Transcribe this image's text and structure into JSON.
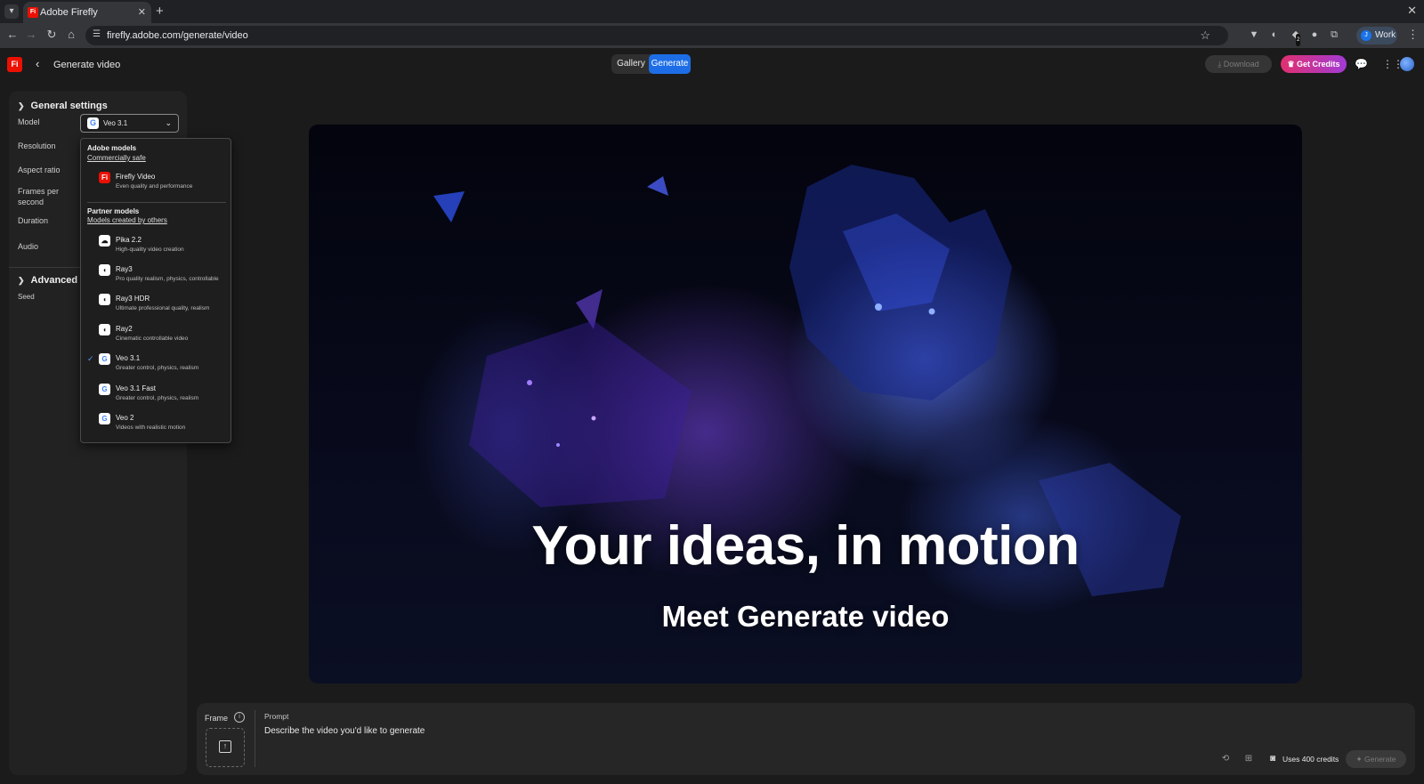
{
  "browser": {
    "tab_title": "Adobe Firefly",
    "tab_favicon": "Fi",
    "url": "firefly.adobe.com/generate/video",
    "extension_badge": "2",
    "profile_initial": "J",
    "profile_name": "Work"
  },
  "header": {
    "logo": "Fi",
    "page_title": "Generate video",
    "segments": [
      "Gallery",
      "Generate"
    ],
    "download_label": "Download",
    "credits_label": "Get Credits"
  },
  "settings": {
    "general_title": "General settings",
    "labels": {
      "model": "Model",
      "resolution": "Resolution",
      "aspect_ratio": "Aspect ratio",
      "fps": "Frames per second",
      "duration": "Duration",
      "audio": "Audio"
    },
    "advanced_title": "Advanced se",
    "seed_label": "Seed",
    "selected_model": "Veo 3.1"
  },
  "dropdown": {
    "adobe_group": {
      "title": "Adobe models",
      "subtitle": "Commercially safe"
    },
    "adobe_options": [
      {
        "name": "Firefly Video",
        "desc": "Even quality and performance",
        "icon": "firefly-icon"
      }
    ],
    "partner_group": {
      "title": "Partner models",
      "subtitle": "Models created by others"
    },
    "partner_options": [
      {
        "name": "Pika 2.2",
        "desc": "High-quality video creation",
        "icon": "pika-icon"
      },
      {
        "name": "Ray3",
        "desc": "Pro quality realism, physics, controllable",
        "icon": "luma-icon"
      },
      {
        "name": "Ray3 HDR",
        "desc": "Ultimate professional quality, realism",
        "icon": "luma-icon"
      },
      {
        "name": "Ray2",
        "desc": "Cinematic controllable video",
        "icon": "luma-icon"
      },
      {
        "name": "Veo 3.1",
        "desc": "Greater control, physics, realism",
        "icon": "google-icon",
        "selected": true
      },
      {
        "name": "Veo 3.1 Fast",
        "desc": "Greater control, physics, realism",
        "icon": "google-icon"
      },
      {
        "name": "Veo 2",
        "desc": "Videos with realistic motion",
        "icon": "google-icon"
      }
    ]
  },
  "hero": {
    "title": "Your ideas, in motion",
    "subtitle": "Meet Generate video"
  },
  "prompt": {
    "frame_label": "Frame",
    "prompt_label": "Prompt",
    "placeholder": "Describe the video you'd like to generate",
    "uses_credits": "Uses 400 credits",
    "generate_label": "Generate"
  },
  "colors": {
    "accent_blue": "#1d6ee6",
    "adobe_red": "#eb1000",
    "credits_gradient_start": "#e0306f",
    "credits_gradient_end": "#a23ad6"
  }
}
